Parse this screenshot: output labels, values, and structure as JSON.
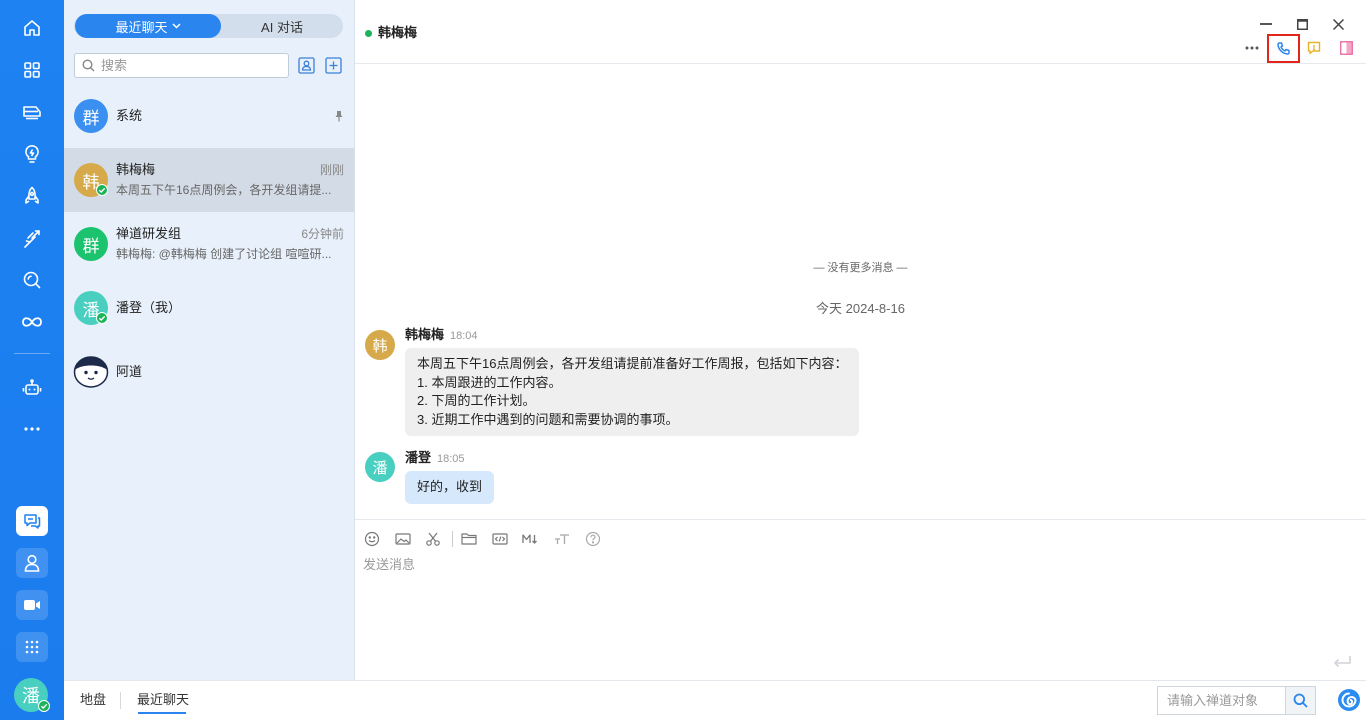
{
  "colors": {
    "accent": "#1f80ef",
    "panel_bg": "#e8f1fb",
    "selected_bg": "#d3dce6",
    "online": "#1db35a",
    "highlight_box": "#e3241b"
  },
  "sidebar": {
    "icons": [
      "home-icon",
      "grid-icon",
      "train-icon",
      "lightbulb-icon",
      "rocket-icon",
      "comet-icon",
      "magnifier-icon",
      "infinity-icon",
      "robot-icon",
      "more-icon"
    ],
    "bottom_icons": [
      "chat-icon",
      "user-icon",
      "video-icon",
      "apps-icon"
    ],
    "user_avatar": "潘",
    "user_avatar_color": "#49cfc0"
  },
  "conversations": {
    "tab_recent": "最近聊天",
    "tab_ai": "AI 对话",
    "search_placeholder": "搜索",
    "items": [
      {
        "avatar": "群",
        "avatar_color": "#3a8ff0",
        "name": "系统",
        "pinned": true
      },
      {
        "avatar": "韩",
        "avatar_color": "#d6a94a",
        "name": "韩梅梅",
        "time": "刚刚",
        "preview": "本周五下午16点周例会，各开发组请提...",
        "online": true,
        "selected": true
      },
      {
        "avatar": "群",
        "avatar_color": "#1cc36e",
        "name": "禅道研发组",
        "time": "6分钟前",
        "preview": "韩梅梅: @韩梅梅 创建了讨论组 喧喧研..."
      },
      {
        "avatar": "潘",
        "avatar_color": "#49cfc0",
        "name": "潘登（我）",
        "online": true
      },
      {
        "name": "阿道"
      }
    ]
  },
  "chat": {
    "contact_name": "韩梅梅",
    "no_more": "— 没有更多消息 —",
    "date": "今天 2024-8-16",
    "messages": [
      {
        "avatar": "韩",
        "avatar_color": "#d6a94a",
        "sender": "韩梅梅",
        "time": "18:04",
        "lines": [
          "本周五下午16点周例会，各开发组请提前准备好工作周报，包括如下内容：",
          "1. 本周跟进的工作内容。",
          "2. 下周的工作计划。",
          "3. 近期工作中遇到的问题和需要协调的事项。"
        ]
      },
      {
        "avatar": "潘",
        "avatar_color": "#49cfc0",
        "sender": "潘登",
        "time": "18:05",
        "lines": [
          "好的，收到"
        ]
      }
    ],
    "input_placeholder": "发送消息"
  },
  "footer": {
    "tab_home": "地盘",
    "tab_recent": "最近聊天",
    "search_placeholder": "请输入禅道对象"
  }
}
